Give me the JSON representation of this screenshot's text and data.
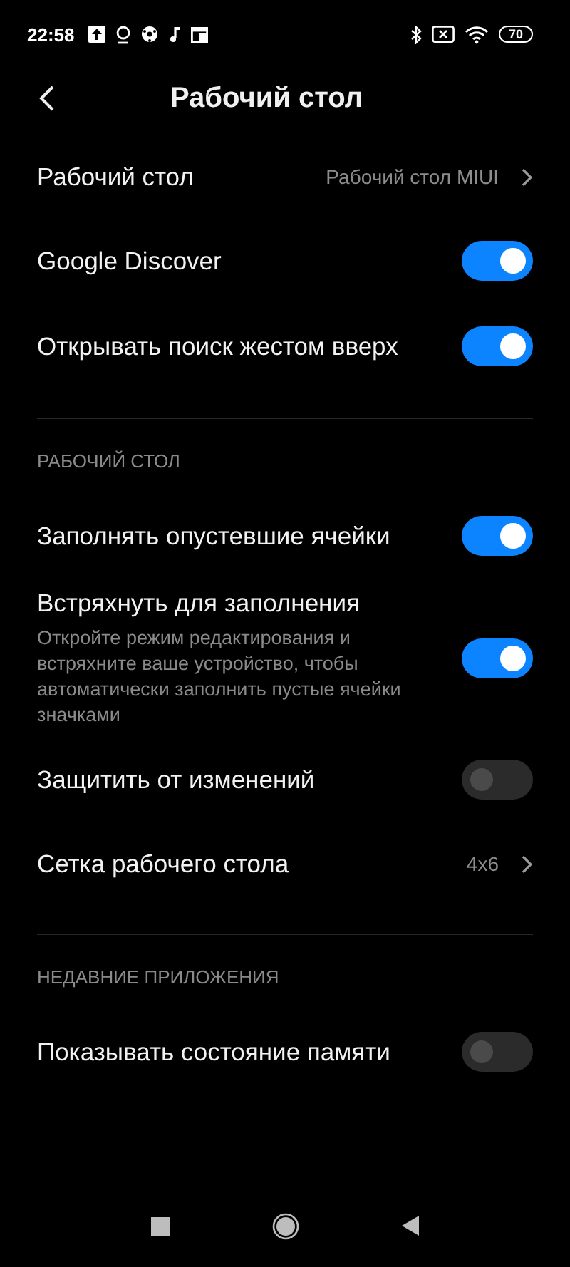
{
  "status_bar": {
    "time": "22:58",
    "battery": "70"
  },
  "header": {
    "title": "Рабочий стол"
  },
  "items": [
    {
      "kind": "link",
      "label": "Рабочий стол",
      "value": "Рабочий стол MIUI"
    },
    {
      "kind": "toggle",
      "label": "Google Discover",
      "on": true
    },
    {
      "kind": "toggle",
      "label": "Открывать поиск жестом вверх",
      "on": true
    },
    {
      "kind": "divider"
    },
    {
      "kind": "section",
      "label": "РАБОЧИЙ СТОЛ"
    },
    {
      "kind": "toggle",
      "label": "Заполнять опустевшие ячейки",
      "on": true
    },
    {
      "kind": "toggle",
      "label": "Встряхнуть для заполнения",
      "description": "Откройте режим редактирования и встряхните ваше устройство, чтобы автоматически заполнить пустые ячейки значками",
      "on": true
    },
    {
      "kind": "toggle",
      "label": "Защитить от изменений",
      "on": false
    },
    {
      "kind": "link",
      "label": "Сетка рабочего стола",
      "value": "4x6"
    },
    {
      "kind": "divider"
    },
    {
      "kind": "section",
      "label": "НЕДАВНИЕ ПРИЛОЖЕНИЯ"
    },
    {
      "kind": "toggle",
      "label": "Показывать состояние памяти",
      "on": false
    }
  ]
}
